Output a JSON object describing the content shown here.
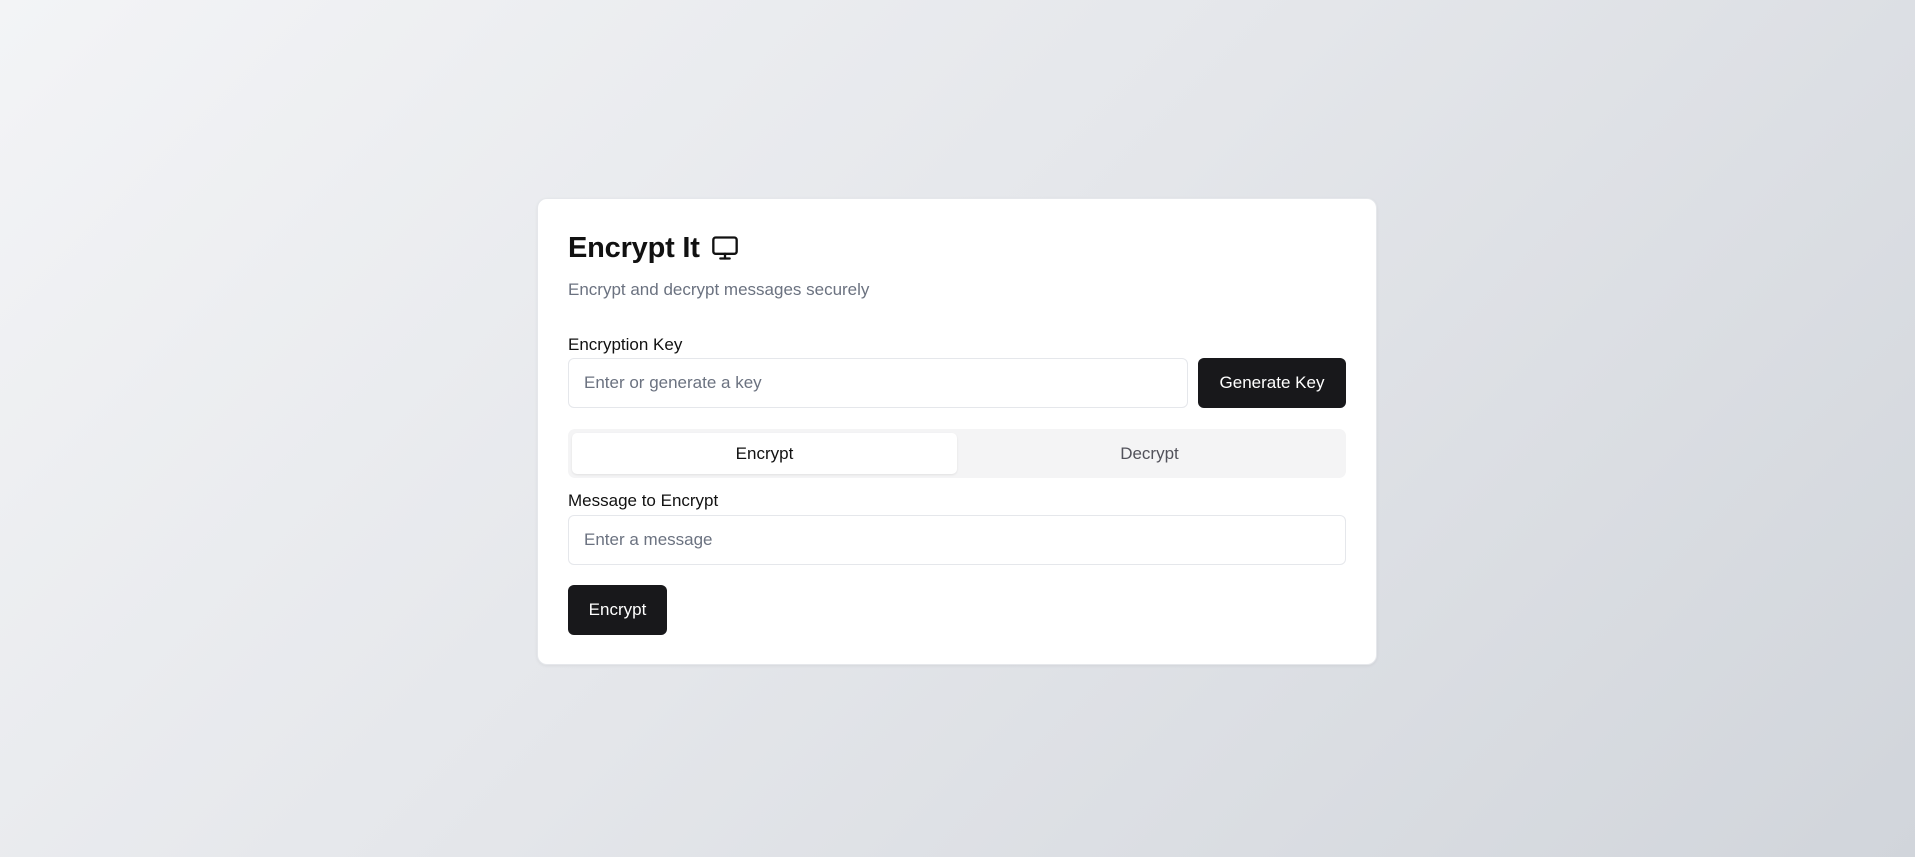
{
  "app": {
    "title": "Encrypt It",
    "title_icon": "monitor-icon",
    "subtitle": "Encrypt and decrypt messages securely"
  },
  "key_section": {
    "label": "Encryption Key",
    "placeholder": "Enter or generate a key",
    "value": "",
    "generate_label": "Generate Key"
  },
  "tabs": [
    {
      "label": "Encrypt",
      "active": true
    },
    {
      "label": "Decrypt",
      "active": false
    }
  ],
  "message_section": {
    "label": "Message to Encrypt",
    "placeholder": "Enter a message",
    "value": "",
    "submit_label": "Encrypt"
  },
  "colors": {
    "primary_button": "#18181b",
    "muted_text": "#6b7280",
    "tab_background": "#f4f4f5",
    "card_background": "#ffffff"
  }
}
